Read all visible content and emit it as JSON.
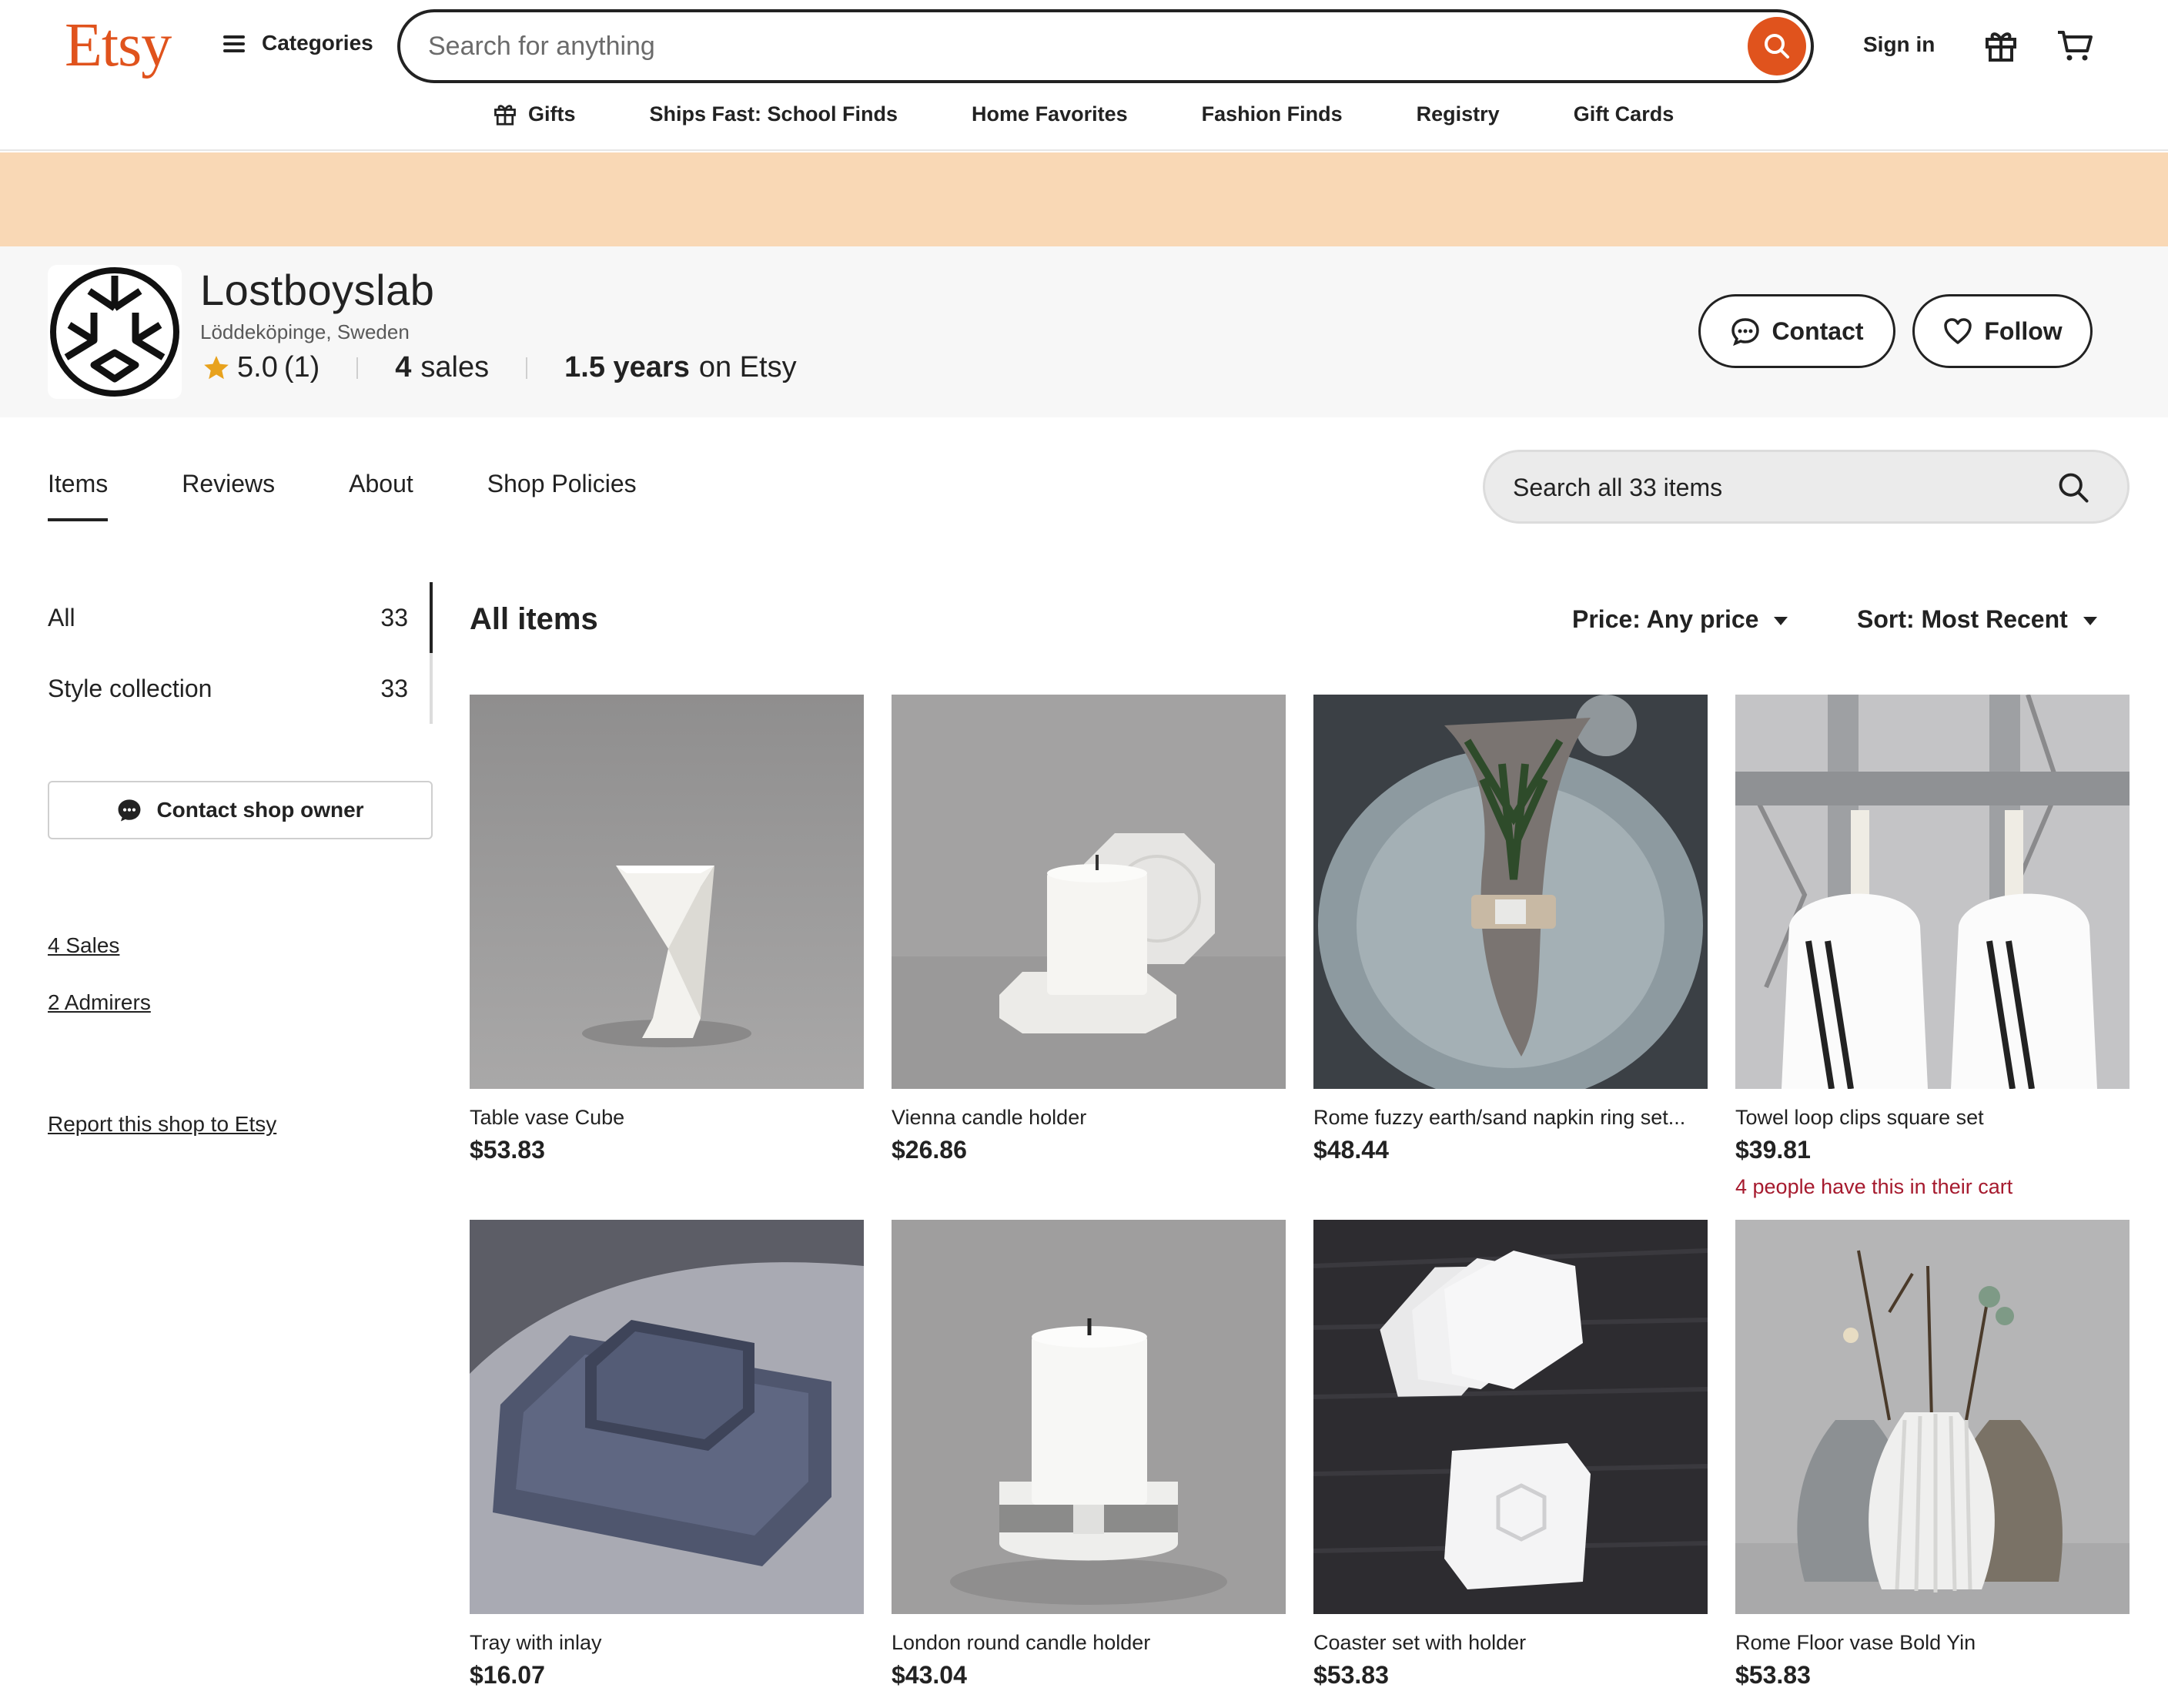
{
  "header": {
    "logo": "Etsy",
    "categories_label": "Categories",
    "search_placeholder": "Search for anything",
    "signin_label": "Sign in",
    "nav": [
      "Gifts",
      "Ships Fast: School Finds",
      "Home Favorites",
      "Fashion Finds",
      "Registry",
      "Gift Cards"
    ]
  },
  "colors": {
    "brand": "#e0531d",
    "banner": "#f9d8b5",
    "cart_note": "#a61a2e"
  },
  "shop": {
    "name": "Lostboyslab",
    "location": "Löddeköpinge, Sweden",
    "rating": "5.0",
    "rating_count": "(1)",
    "sales_num": "4",
    "sales_word": "sales",
    "years_num": "1.5 years",
    "years_word": "on Etsy",
    "contact_label": "Contact",
    "follow_label": "Follow"
  },
  "tabs": [
    "Items",
    "Reviews",
    "About",
    "Shop Policies"
  ],
  "shop_search_placeholder": "Search all 33 items",
  "sidebar": {
    "categories": [
      {
        "label": "All",
        "count": "33"
      },
      {
        "label": "Style collection",
        "count": "33"
      }
    ],
    "contact_owner": "Contact shop owner",
    "sales_link": "4 Sales",
    "admirers_link": "2 Admirers",
    "report_link": "Report this shop to Etsy"
  },
  "listing": {
    "heading": "All items",
    "price_filter": "Price: Any price",
    "sort_filter": "Sort: Most Recent"
  },
  "items": [
    {
      "title": "Table vase Cube",
      "price": "$53.83"
    },
    {
      "title": "Vienna candle holder",
      "price": "$26.86"
    },
    {
      "title": "Rome fuzzy earth/sand napkin ring set...",
      "price": "$48.44"
    },
    {
      "title": "Towel loop clips square set",
      "price": "$39.81",
      "note": "4 people have this in their cart"
    },
    {
      "title": "Tray with inlay",
      "price": "$16.07"
    },
    {
      "title": "London round candle holder",
      "price": "$43.04"
    },
    {
      "title": "Coaster set with holder",
      "price": "$53.83"
    },
    {
      "title": "Rome Floor vase Bold Yin",
      "price": "$53.83"
    }
  ]
}
